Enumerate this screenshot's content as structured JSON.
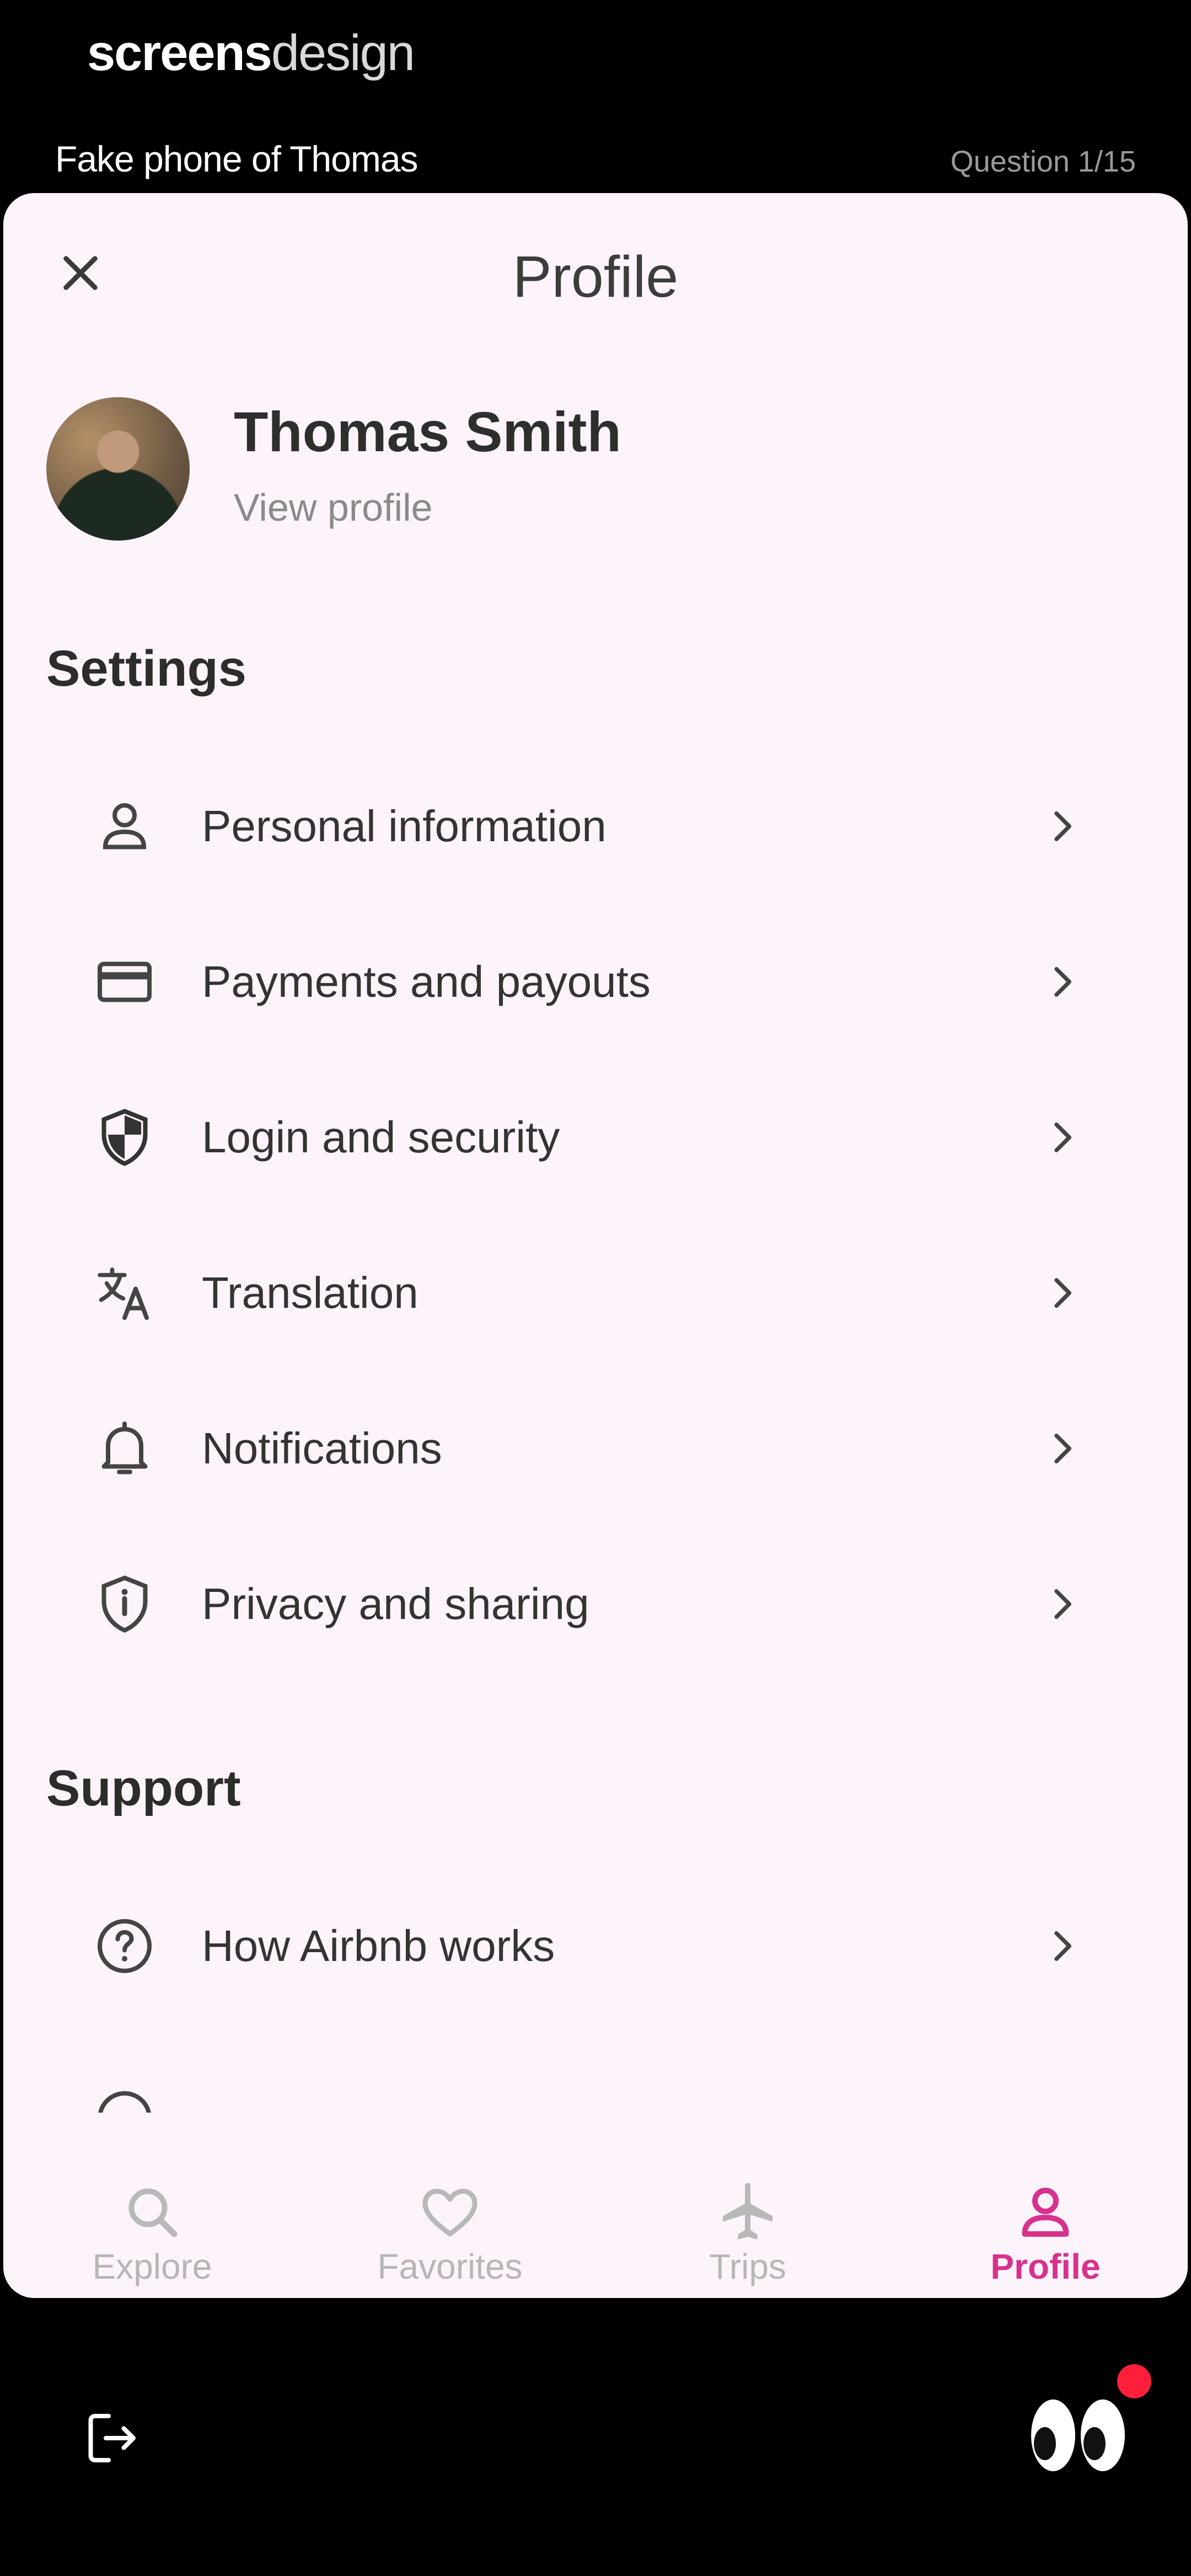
{
  "brand": {
    "bold": "screens",
    "light": "design"
  },
  "device": {
    "label": "Fake phone of Thomas",
    "question": "Question 1/15"
  },
  "header": {
    "title": "Profile"
  },
  "profile": {
    "name": "Thomas Smith",
    "view_link": "View profile"
  },
  "settings": {
    "title": "Settings",
    "items": [
      {
        "label": "Personal information",
        "icon": "person-icon"
      },
      {
        "label": "Payments and payouts",
        "icon": "card-icon"
      },
      {
        "label": "Login and security",
        "icon": "shield-icon"
      },
      {
        "label": "Translation",
        "icon": "translate-icon"
      },
      {
        "label": "Notifications",
        "icon": "bell-icon"
      },
      {
        "label": "Privacy and sharing",
        "icon": "privacy-icon"
      }
    ]
  },
  "support": {
    "title": "Support",
    "items": [
      {
        "label": "How Airbnb works",
        "icon": "help-icon"
      }
    ]
  },
  "tabs": [
    {
      "label": "Explore",
      "icon": "search-icon",
      "active": false
    },
    {
      "label": "Favorites",
      "icon": "heart-icon",
      "active": false
    },
    {
      "label": "Trips",
      "icon": "plane-icon",
      "active": false
    },
    {
      "label": "Profile",
      "icon": "person-icon",
      "active": true
    }
  ],
  "colors": {
    "accent": "#d8318d",
    "sheet_bg": "#fdf3fb",
    "notification_dot": "#ff1f3a"
  }
}
